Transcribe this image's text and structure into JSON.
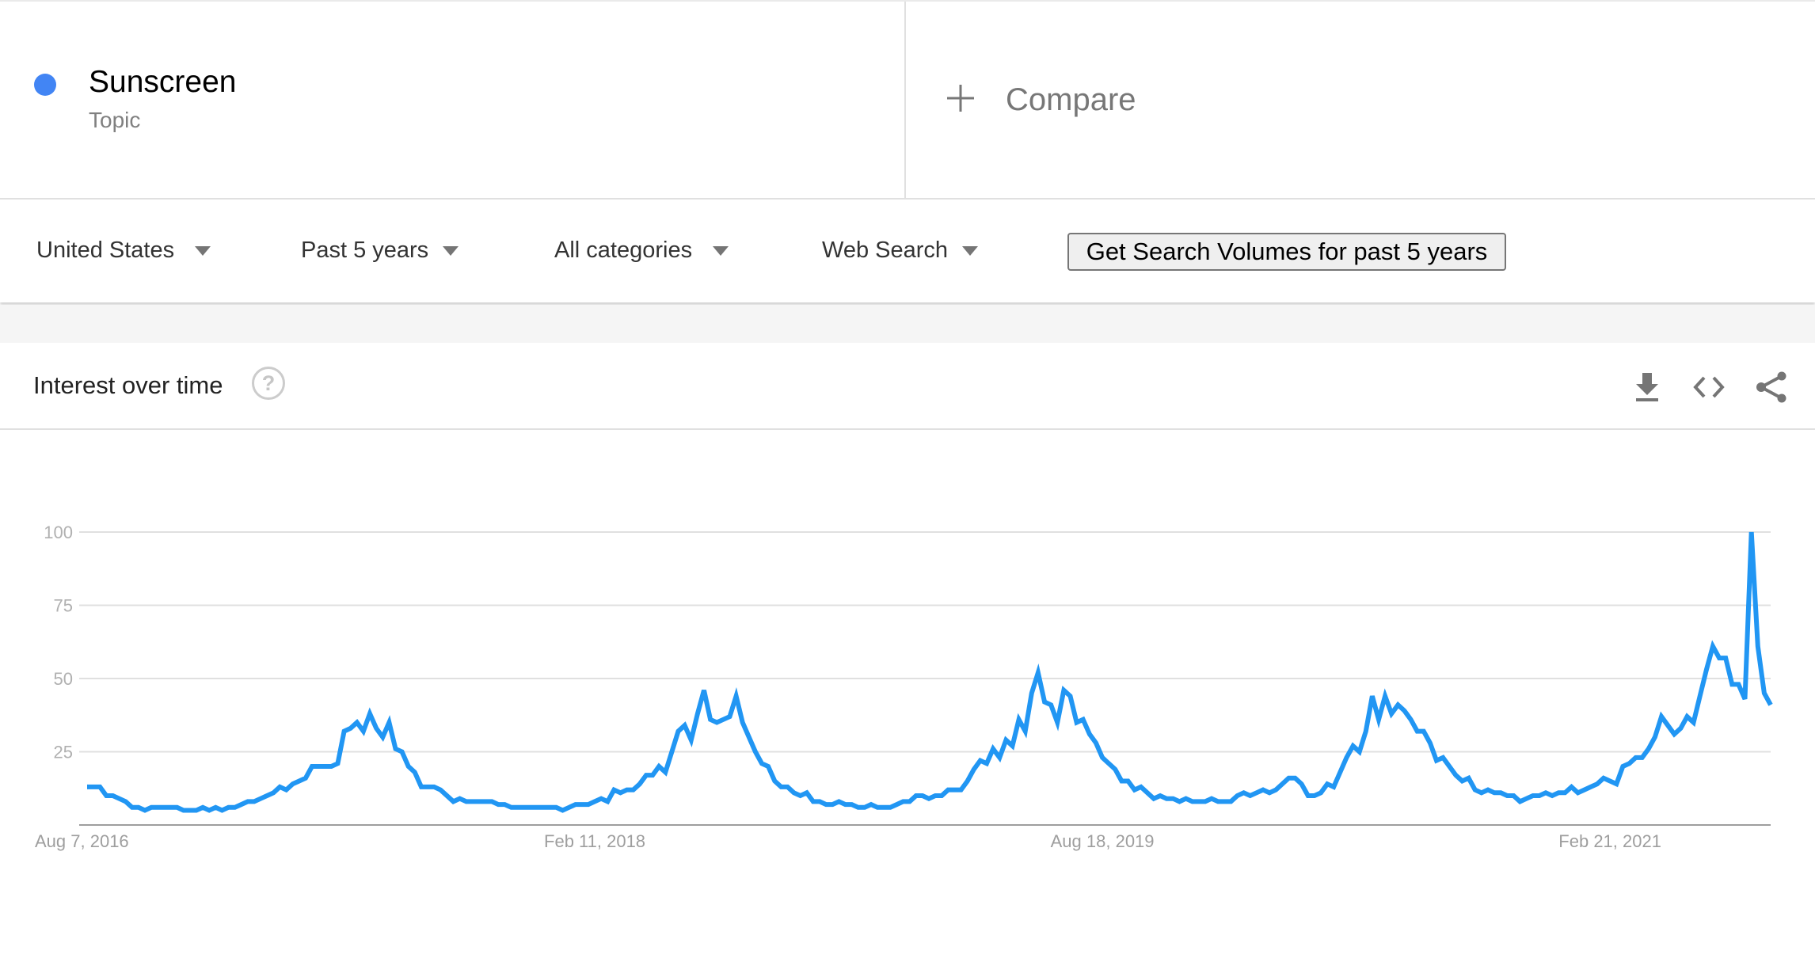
{
  "term": {
    "name": "Sunscreen",
    "type": "Topic",
    "color": "#4285f4"
  },
  "compare": {
    "icon": "plus-icon",
    "label": "Compare"
  },
  "filters": {
    "region": "United States",
    "time_range": "Past 5 years",
    "category": "All categories",
    "search_type": "Web Search",
    "volume_button": "Get Search Volumes for past 5 years"
  },
  "card": {
    "title": "Interest over time",
    "help_icon": "help-circle-icon",
    "actions": [
      "download-icon",
      "embed-code-icon",
      "share-icon"
    ]
  },
  "chart_data": {
    "type": "line",
    "title": "Interest over time",
    "xlabel": "",
    "ylabel": "",
    "ylim": [
      0,
      100
    ],
    "yticks": [
      25,
      50,
      75,
      100
    ],
    "xtick_labels": [
      "Aug 7, 2016",
      "Feb 11, 2018",
      "Aug 18, 2019",
      "Feb 21, 2021"
    ],
    "xtick_index": [
      0,
      79,
      158,
      237
    ],
    "grid": true,
    "legend": "none",
    "series": [
      {
        "name": "Sunscreen",
        "color": "#2196f3",
        "values": [
          13,
          13,
          13,
          10,
          10,
          9,
          8,
          6,
          6,
          5,
          6,
          6,
          6,
          6,
          6,
          5,
          5,
          5,
          6,
          5,
          6,
          5,
          6,
          6,
          7,
          8,
          8,
          9,
          10,
          11,
          13,
          12,
          14,
          15,
          16,
          20,
          20,
          20,
          20,
          21,
          32,
          33,
          35,
          32,
          38,
          33,
          30,
          35,
          26,
          25,
          20,
          18,
          13,
          13,
          13,
          12,
          10,
          8,
          9,
          8,
          8,
          8,
          8,
          8,
          7,
          7,
          6,
          6,
          6,
          6,
          6,
          6,
          6,
          6,
          5,
          6,
          7,
          7,
          7,
          8,
          9,
          8,
          12,
          11,
          12,
          12,
          14,
          17,
          17,
          20,
          18,
          25,
          32,
          34,
          29,
          38,
          46,
          36,
          35,
          36,
          37,
          44,
          35,
          30,
          25,
          21,
          20,
          15,
          13,
          13,
          11,
          10,
          11,
          8,
          8,
          7,
          7,
          8,
          7,
          7,
          6,
          6,
          7,
          6,
          6,
          6,
          7,
          8,
          8,
          10,
          10,
          9,
          10,
          10,
          12,
          12,
          12,
          15,
          19,
          22,
          21,
          26,
          23,
          29,
          27,
          36,
          32,
          45,
          52,
          42,
          41,
          35,
          46,
          44,
          35,
          36,
          31,
          28,
          23,
          21,
          19,
          15,
          15,
          12,
          13,
          11,
          9,
          10,
          9,
          9,
          8,
          9,
          8,
          8,
          8,
          9,
          8,
          8,
          8,
          10,
          11,
          10,
          11,
          12,
          11,
          12,
          14,
          16,
          16,
          14,
          10,
          10,
          11,
          14,
          13,
          18,
          23,
          27,
          25,
          32,
          44,
          36,
          44,
          38,
          41,
          39,
          36,
          32,
          32,
          28,
          22,
          23,
          20,
          17,
          15,
          16,
          12,
          11,
          12,
          11,
          11,
          10,
          10,
          8,
          9,
          10,
          10,
          11,
          10,
          11,
          11,
          13,
          11,
          12,
          13,
          14,
          16,
          15,
          14,
          20,
          21,
          23,
          23,
          26,
          30,
          37,
          34,
          31,
          33,
          37,
          35,
          44,
          53,
          61,
          57,
          57,
          48,
          48,
          43,
          100,
          61,
          45,
          41
        ]
      }
    ]
  }
}
